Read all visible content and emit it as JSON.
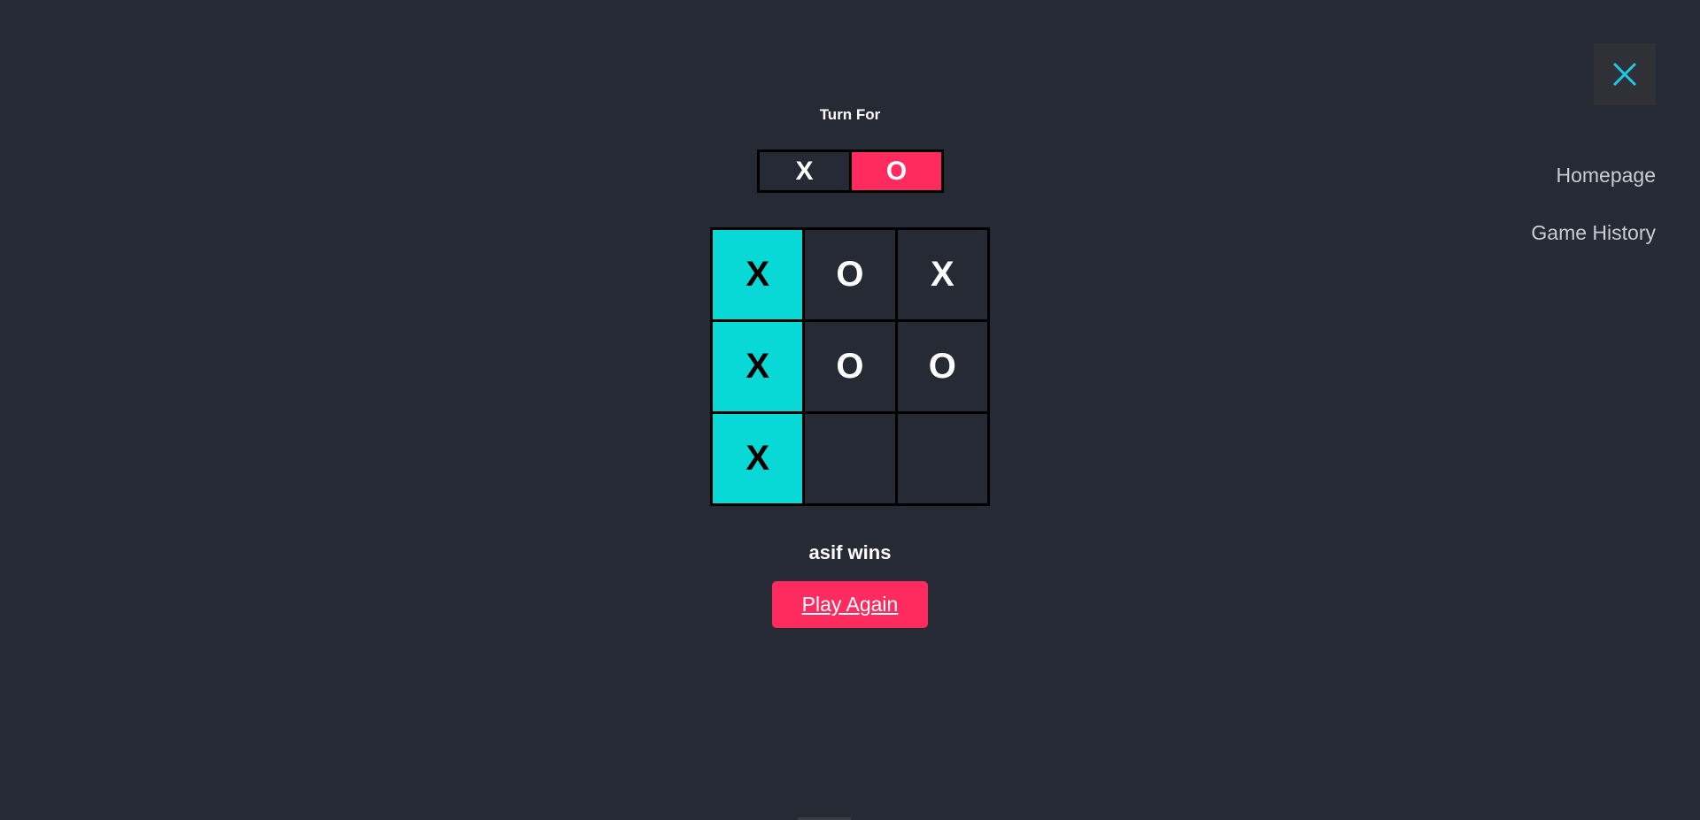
{
  "header": {
    "close_icon": "close-icon",
    "close_color": "#1ec8e8"
  },
  "nav": {
    "homepage": "Homepage",
    "game_history": "Game History"
  },
  "turn": {
    "label": "Turn For",
    "x_label": "X",
    "o_label": "O",
    "active": "O"
  },
  "board": {
    "cells": [
      "X",
      "O",
      "X",
      "X",
      "O",
      "O",
      "X",
      "",
      ""
    ],
    "winning_cells": [
      0,
      3,
      6
    ],
    "win_color": "#08d9d6"
  },
  "result": {
    "text": "asif wins"
  },
  "actions": {
    "play_again": "Play Again"
  },
  "colors": {
    "background": "#262a35",
    "accent": "#ff2b5e"
  }
}
